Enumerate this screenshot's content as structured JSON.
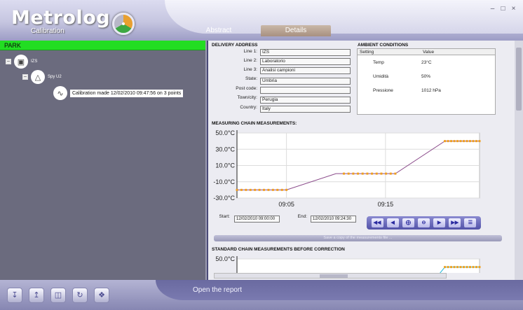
{
  "app": {
    "logo": "Metrolog",
    "subtitle": "Calibration"
  },
  "window_controls": [
    "minimize-icon",
    "restore-icon",
    "close-icon"
  ],
  "tabs": [
    {
      "label": "Abstract",
      "active": false
    },
    {
      "label": "Details",
      "active": true
    }
  ],
  "tree": {
    "root": "PARK",
    "site": "IZS",
    "device": "Spy U2",
    "calibration": "Calibration made 12/02/2010 09:47:56 on 3 points"
  },
  "delivery": {
    "title": "DELIVERY ADDRESS",
    "fields": [
      {
        "label": "Line 1:",
        "value": "IZS"
      },
      {
        "label": "Line 2:",
        "value": "Laboratorio"
      },
      {
        "label": "Line 3:",
        "value": "Analisi campioni"
      },
      {
        "label": "State:",
        "value": "Umbria"
      },
      {
        "label": "Post code:",
        "value": ""
      },
      {
        "label": "Town/city:",
        "value": "Perugia"
      },
      {
        "label": "Country:",
        "value": "Italy"
      }
    ]
  },
  "ambient": {
    "title": "AMBIENT CONDITIONS",
    "columns": [
      "Setting",
      "Value"
    ],
    "rows": [
      {
        "setting": "Temp",
        "value": "23°C"
      },
      {
        "setting": "Umidità",
        "value": "50%"
      },
      {
        "setting": "Pressione",
        "value": "1012 hPa"
      }
    ]
  },
  "measuring": {
    "title": "MEASURING CHAIN MEASUREMENTS:",
    "start_label": "Start:",
    "start_value": "12/02/2010 09:00:00",
    "end_label": "End:",
    "end_value": "12/02/2010 09:24:30",
    "save_label": "Save a copy of the measurements file ..."
  },
  "standard": {
    "title": "STANDARD CHAIN MEASUREMENTS BEFORE CORRECTION"
  },
  "nav_buttons": [
    "rewind-icon",
    "step-back-icon",
    "add-icon",
    "remove-icon",
    "step-forward-icon",
    "fast-forward-icon",
    "list-icon"
  ],
  "footer": {
    "open_report": "Open the report"
  },
  "colors": {
    "accent_green": "#22dd22",
    "series_line": "#8a4a8a",
    "series_marker": "#f0a020",
    "standard_line": "#20b8d8"
  },
  "chart_data": [
    {
      "type": "line",
      "title": "MEASURING CHAIN MEASUREMENTS:",
      "ylim": [
        -30,
        50
      ],
      "yticks": [
        "50.0°C",
        "30.0°C",
        "10.0°C",
        "-10.0°C",
        "-30.0°C"
      ],
      "ytick_values": [
        50,
        30,
        10,
        -10,
        -30
      ],
      "xticks": [
        "09:05",
        "09:15"
      ],
      "xtick_minutes": [
        5,
        15
      ],
      "x_minutes": [
        0,
        5,
        10,
        10.8,
        16,
        21,
        24.5
      ],
      "y": [
        -20,
        -20,
        0,
        0,
        0,
        40,
        40
      ],
      "markers": [
        {
          "from": 0,
          "to": 5,
          "y": -20,
          "count": 12
        },
        {
          "from": 10.8,
          "to": 16,
          "y": 0,
          "count": 12
        },
        {
          "from": 21,
          "to": 24.5,
          "y": 40,
          "count": 12
        }
      ],
      "grid": true
    },
    {
      "type": "line",
      "title": "STANDARD CHAIN MEASUREMENTS BEFORE CORRECTION",
      "ylim": [
        -30,
        50
      ],
      "yticks": [
        "50.0°C"
      ],
      "ytick_values": [
        50
      ],
      "x_minutes": [
        20,
        21,
        24.5
      ],
      "y": [
        25,
        40,
        40
      ],
      "markers": [
        {
          "from": 21,
          "to": 24.5,
          "y": 40,
          "count": 12
        }
      ],
      "grid": true
    }
  ]
}
